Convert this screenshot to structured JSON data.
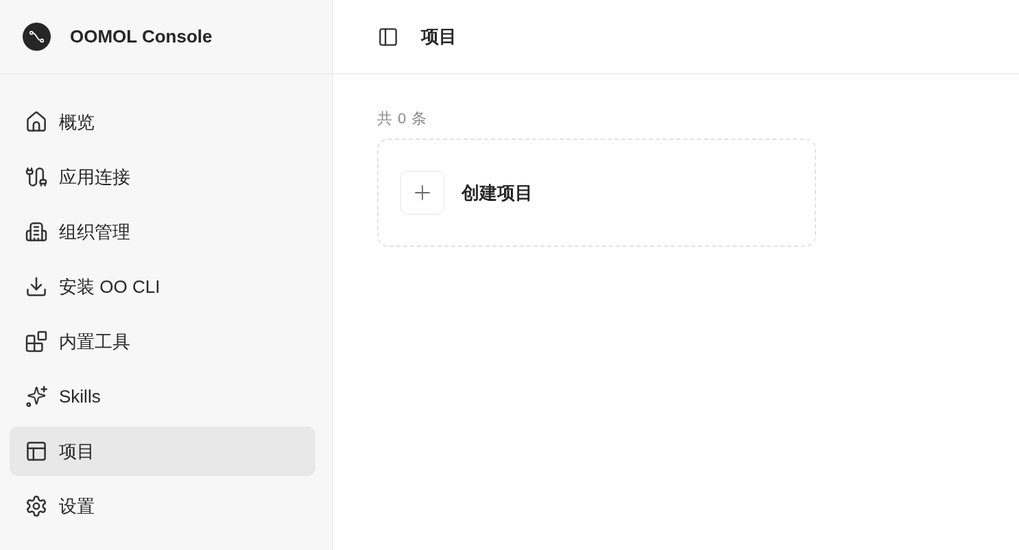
{
  "sidebar": {
    "brand": "OOMOL Console",
    "items": [
      {
        "label": "概览",
        "selected": false
      },
      {
        "label": "应用连接",
        "selected": false
      },
      {
        "label": "组织管理",
        "selected": false
      },
      {
        "label": "安装 OO CLI",
        "selected": false
      },
      {
        "label": "内置工具",
        "selected": false
      },
      {
        "label": "Skills",
        "selected": false
      },
      {
        "label": "项目",
        "selected": true
      },
      {
        "label": "设置",
        "selected": false
      }
    ]
  },
  "header": {
    "title": "项目"
  },
  "content": {
    "count": "共 0 条",
    "create_card": {
      "label": "创建项目"
    }
  }
}
